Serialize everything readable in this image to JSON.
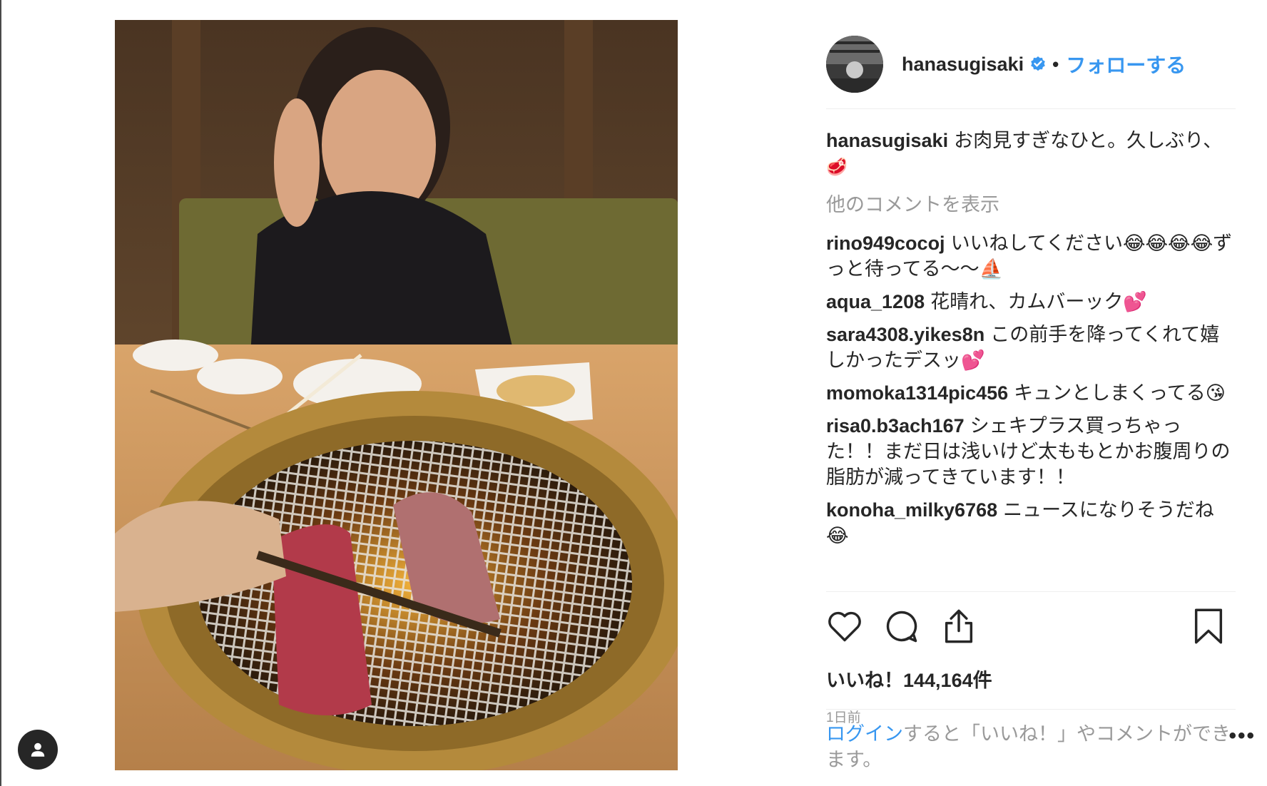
{
  "post": {
    "username": "hanasugisaki",
    "follow_label": "フォローする",
    "dot": "•",
    "caption": "お肉見すぎなひと。久しぶり、",
    "caption_emoji": "🥩",
    "more_comments": "他のコメントを表示",
    "comments": [
      {
        "user": "rino949cocoj",
        "text": "いいねしてください😂😂😂😂ずっと待ってる〜〜⛵"
      },
      {
        "user": "aqua_1208",
        "text": "花晴れ、カムバーック💕"
      },
      {
        "user": "sara4308.yikes8n",
        "text": "この前手を降ってくれて嬉しかったデスッ💕"
      },
      {
        "user": "momoka1314pic456",
        "text": "キュンとしまくってる😘"
      },
      {
        "user": "risa0.b3ach167",
        "text": "シェキプラス買っちゃった！！まだ日は浅いけど太ももとかお腹周りの脂肪が減ってきています！！"
      },
      {
        "user": "konoha_milky6768",
        "text": "ニュースになりそうだね😂"
      }
    ],
    "likes": "いいね！144,164件",
    "timestamp": "1日前",
    "login_link": "ログイン",
    "login_rest": "すると「いいね！」やコメントができます。",
    "more_options": "•••"
  },
  "icons": {
    "verified": "verified-badge-icon",
    "like": "heart-icon",
    "comment": "comment-bubble-icon",
    "share": "share-icon",
    "bookmark": "bookmark-icon",
    "profile": "person-icon"
  },
  "colors": {
    "link_blue": "#3897f0",
    "text": "#262626",
    "muted": "#999999",
    "divider": "#efefef"
  }
}
